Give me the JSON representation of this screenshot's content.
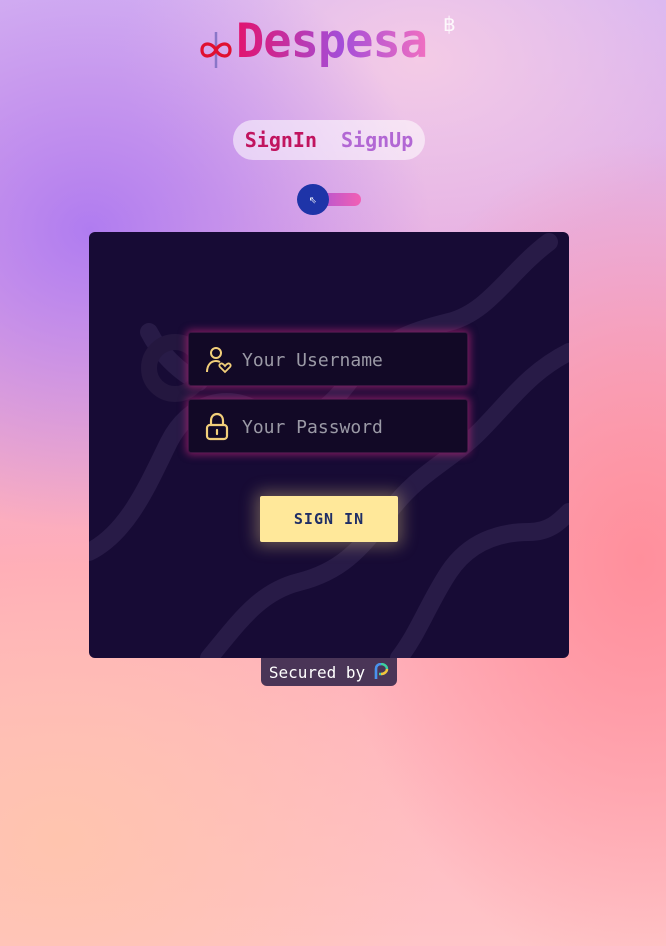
{
  "brand": {
    "name": "Despesa",
    "logo_icon": "infinity-icon",
    "coin_glyph": "฿"
  },
  "tabs": [
    {
      "label": "SignIn",
      "active": true
    },
    {
      "label": "SignUp",
      "active": false
    }
  ],
  "theme_toggle": {
    "icon": "brush-icon",
    "glyph": "⇖"
  },
  "form": {
    "username": {
      "placeholder": "Your Username",
      "value": "",
      "icon": "user-heart-icon"
    },
    "password": {
      "placeholder": "Your Password",
      "value": "",
      "icon": "lock-icon"
    },
    "submit_label": "SIGN IN"
  },
  "footer": {
    "secured_label": "Secured by",
    "provider_icon": "passage-logo-icon"
  },
  "colors": {
    "accent_pink": "#e2136e",
    "accent_purple": "#a44ed8",
    "card_bg": "#170b35",
    "button_bg": "#ffe89a",
    "button_text": "#1f2e66",
    "field_glow": "#d42882",
    "toggle_knob": "#1e34a8"
  }
}
